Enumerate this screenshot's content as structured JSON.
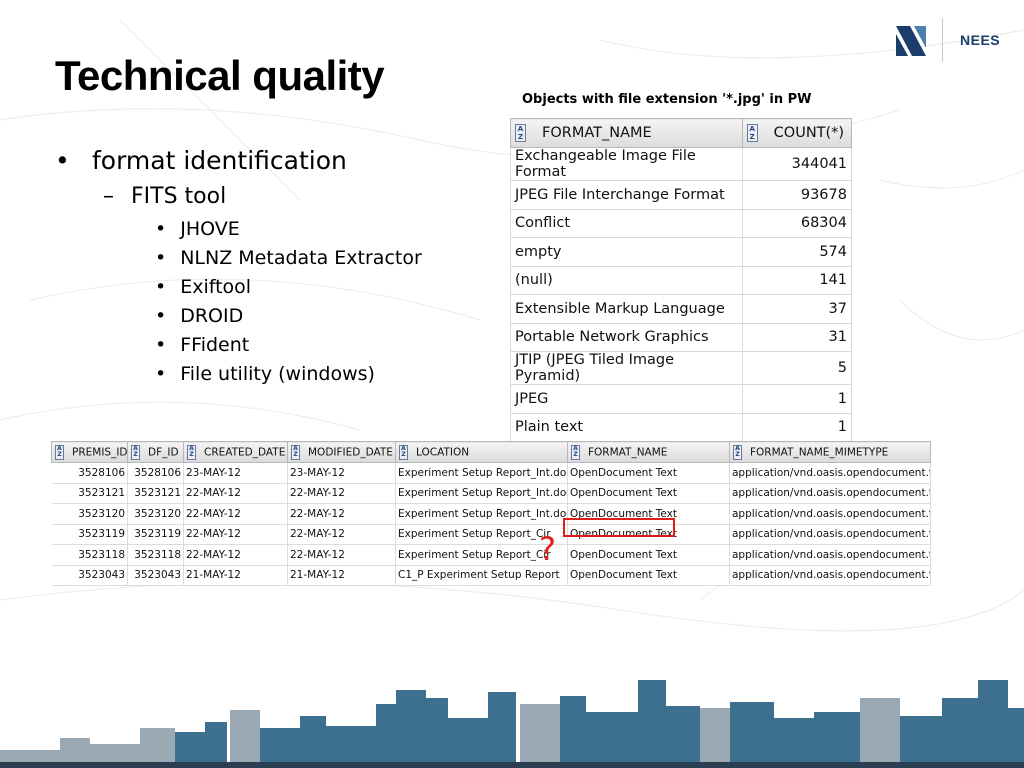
{
  "slide": {
    "title": "Technical quality",
    "logo_text": "NEES",
    "caption": "Objects with file extension '*.jpg' in PW"
  },
  "bullets": {
    "level1": {
      "marker": "•",
      "text": "format identification"
    },
    "level2": {
      "marker": "–",
      "text": "FITS tool"
    },
    "level3": [
      {
        "marker": "•",
        "text": "JHOVE"
      },
      {
        "marker": "•",
        "text": "NLNZ Metadata Extractor"
      },
      {
        "marker": "•",
        "text": "Exiftool"
      },
      {
        "marker": "•",
        "text": "DROID"
      },
      {
        "marker": "•",
        "text": "FFident"
      },
      {
        "marker": "•",
        "text": "File utility (windows)"
      }
    ]
  },
  "format_grid": {
    "columns": [
      "FORMAT_NAME",
      "COUNT(*)"
    ],
    "rows": [
      {
        "name": "Exchangeable Image File Format",
        "count": "344041"
      },
      {
        "name": "JPEG File Interchange Format",
        "count": "93678"
      },
      {
        "name": "Conflict",
        "count": "68304"
      },
      {
        "name": "empty",
        "count": "574"
      },
      {
        "name": "(null)",
        "count": "141"
      },
      {
        "name": "Extensible Markup Language",
        "count": "37"
      },
      {
        "name": "Portable Network Graphics",
        "count": "31"
      },
      {
        "name": "JTIP (JPEG Tiled Image Pyramid)",
        "count": "5"
      },
      {
        "name": "JPEG",
        "count": "1"
      },
      {
        "name": "Plain text",
        "count": "1"
      }
    ]
  },
  "object_grid": {
    "columns": [
      "PREMIS_ID",
      "DF_ID",
      "CREATED_DATE",
      "MODIFIED_DATE",
      "LOCATION",
      "FORMAT_NAME",
      "FORMAT_NAME_MIMETYPE"
    ],
    "rows": [
      [
        "3528106",
        "3528106",
        "23-MAY-12",
        "23-MAY-12",
        "Experiment Setup Report_Int.docx",
        "OpenDocument Text",
        "application/vnd.oasis.opendocument.text"
      ],
      [
        "3523121",
        "3523121",
        "22-MAY-12",
        "22-MAY-12",
        "Experiment Setup Report_Int.docx",
        "OpenDocument Text",
        "application/vnd.oasis.opendocument.text"
      ],
      [
        "3523120",
        "3523120",
        "22-MAY-12",
        "22-MAY-12",
        "Experiment Setup Report_Int.docx",
        "OpenDocument Text",
        "application/vnd.oasis.opendocument.text"
      ],
      [
        "3523119",
        "3523119",
        "22-MAY-12",
        "22-MAY-12",
        "Experiment Setup Report_Cir",
        "OpenDocument Text",
        "application/vnd.oasis.opendocument.text"
      ],
      [
        "3523118",
        "3523118",
        "22-MAY-12",
        "22-MAY-12",
        "Experiment Setup Report_Cir",
        "OpenDocument Text",
        "application/vnd.oasis.opendocument.text"
      ],
      [
        "3523043",
        "3523043",
        "21-MAY-12",
        "21-MAY-12",
        "C1_P Experiment Setup Report",
        "OpenDocument Text",
        "application/vnd.oasis.opendocument.text"
      ]
    ]
  },
  "annotation": {
    "question_mark": "?",
    "highlight_color": "#e01b1b"
  },
  "colors": {
    "skyline": "#3d6f8e",
    "logo": "#1c3d6b"
  }
}
